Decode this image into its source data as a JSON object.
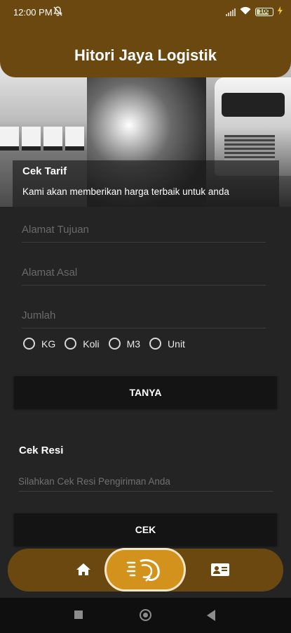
{
  "status_bar": {
    "time": "12:00 PM",
    "battery": "100",
    "icons": [
      "silent-icon",
      "signal-icon",
      "wifi-icon",
      "battery-icon",
      "charging-icon"
    ]
  },
  "header": {
    "title": "Hitori Jaya Logistik"
  },
  "tarif": {
    "title": "Cek Tarif",
    "subtitle": "Kami akan memberikan harga terbaik untuk anda",
    "tujuan_placeholder": "Alamat Tujuan",
    "asal_placeholder": "Alamat Asal",
    "jumlah_placeholder": "Jumlah",
    "units": [
      {
        "label": "KG",
        "selected": false
      },
      {
        "label": "Koli",
        "selected": false
      },
      {
        "label": "M3",
        "selected": false
      },
      {
        "label": "Unit",
        "selected": false
      }
    ],
    "button": "TANYA"
  },
  "resi": {
    "title": "Cek Resi",
    "placeholder": "Silahkan Cek Resi Pengiriman Anda",
    "button": "CEK"
  },
  "bottom_nav": {
    "items": [
      "home-icon",
      "logo-icon",
      "contact-card-icon"
    ]
  },
  "colors": {
    "brand": "#6b4810",
    "accent": "#d3921b",
    "background": "#242424",
    "button": "#141414"
  }
}
